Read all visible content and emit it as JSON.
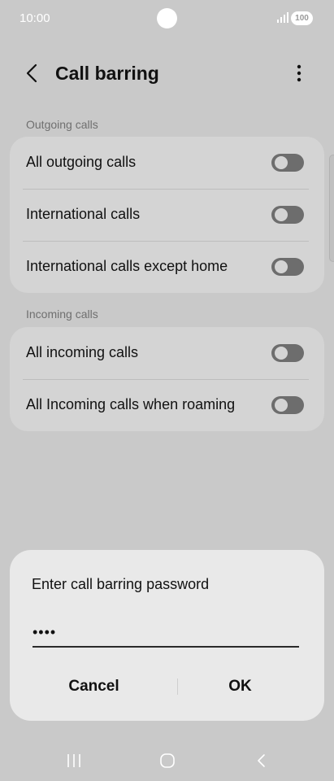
{
  "status_bar": {
    "time": "10:00",
    "battery": "100",
    "icons": [
      "signal-icon",
      "battery-icon"
    ]
  },
  "app_bar": {
    "title": "Call barring",
    "icons": [
      "back-arrow-icon",
      "more-options-icon"
    ]
  },
  "sections": [
    {
      "header": "Outgoing calls",
      "items": [
        {
          "label": "All outgoing calls",
          "enabled": false
        },
        {
          "label": "International calls",
          "enabled": false
        },
        {
          "label": "International calls except home",
          "enabled": false
        }
      ]
    },
    {
      "header": "Incoming calls",
      "items": [
        {
          "label": "All incoming calls",
          "enabled": false
        },
        {
          "label": "All Incoming calls when roaming",
          "enabled": false
        }
      ]
    }
  ],
  "dialog": {
    "title": "Enter call barring password",
    "password_value": "••••",
    "cancel_label": "Cancel",
    "ok_label": "OK"
  },
  "nav_bar": {
    "icons": [
      "recent-apps-icon",
      "home-icon",
      "back-icon"
    ]
  },
  "colors": {
    "overlay_background": "#c9c9c9",
    "card_background": "#d4d4d4",
    "dialog_background": "#e9e9e9",
    "toggle_off": "#6d6d6d"
  }
}
